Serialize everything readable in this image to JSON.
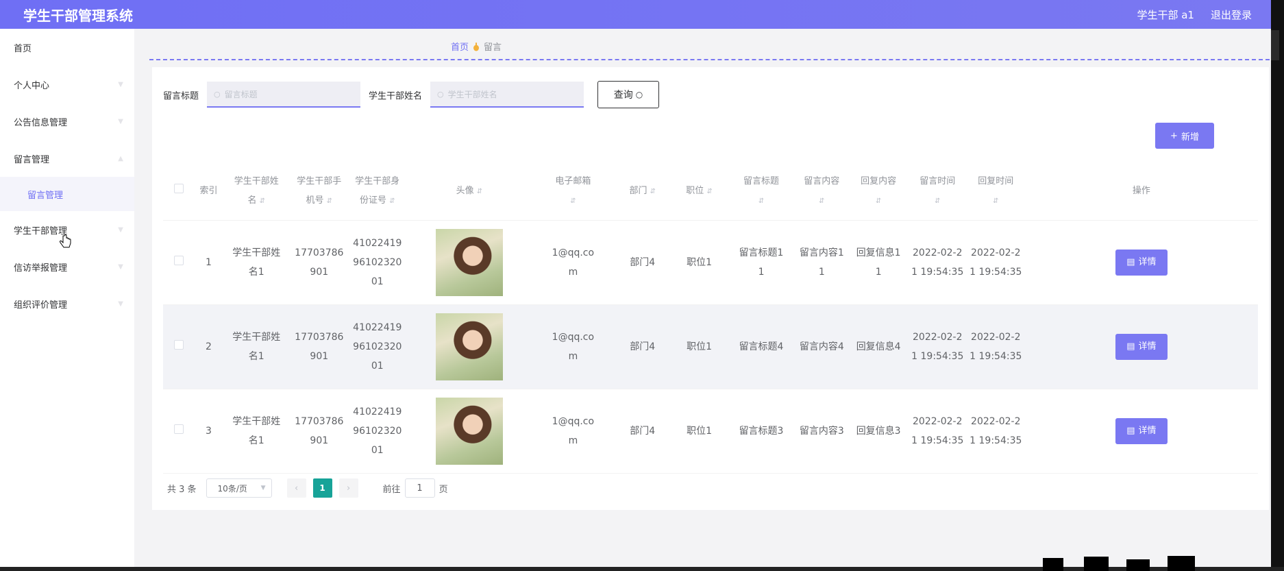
{
  "header": {
    "title": "学生干部管理系统",
    "user": "学生干部 a1",
    "logout": "退出登录"
  },
  "sidebar": {
    "items": [
      {
        "label": "首页"
      },
      {
        "label": "个人中心"
      },
      {
        "label": "公告信息管理"
      },
      {
        "label": "留言管理"
      },
      {
        "label": "学生干部管理"
      },
      {
        "label": "信访举报管理"
      },
      {
        "label": "组织评价管理"
      }
    ],
    "sub_item": "留言管理"
  },
  "breadcrumb": {
    "home": "首页",
    "current": "留言"
  },
  "search": {
    "label1": "留言标题",
    "placeholder1": "留言标题",
    "label2": "学生干部姓名",
    "placeholder2": "学生干部姓名",
    "query_label": "查询"
  },
  "add_label": "新增",
  "table": {
    "headers": {
      "index": "索引",
      "name_a": "学生干部姓",
      "name_b": "名",
      "phone_a": "学生干部手",
      "phone_b": "机号",
      "id_a": "学生干部身",
      "id_b": "份证号",
      "avatar": "头像",
      "email": "电子邮箱",
      "dept": "部门",
      "position": "职位",
      "title": "留言标题",
      "content": "留言内容",
      "reply": "回复内容",
      "time": "留言时间",
      "reply_time": "回复时间",
      "action": "操作"
    },
    "rows": [
      {
        "index": "1",
        "name_a": "学生干部姓",
        "name_b": "名1",
        "phone_a": "17703786",
        "phone_b": "901",
        "id_a": "41022419",
        "id_b": "96102320",
        "id_c": "01",
        "email_a": "1@qq.co",
        "email_b": "m",
        "dept": "部门4",
        "position": "职位1",
        "title_a": "留言标题1",
        "title_b": "1",
        "content_a": "留言内容1",
        "content_b": "1",
        "reply_a": "回复信息1",
        "reply_b": "1",
        "time_a": "2022-02-2",
        "time_b": "1 19:54:35",
        "rtime_a": "2022-02-2",
        "rtime_b": "1 19:54:35",
        "detail": "详情"
      },
      {
        "index": "2",
        "name_a": "学生干部姓",
        "name_b": "名1",
        "phone_a": "17703786",
        "phone_b": "901",
        "id_a": "41022419",
        "id_b": "96102320",
        "id_c": "01",
        "email_a": "1@qq.co",
        "email_b": "m",
        "dept": "部门4",
        "position": "职位1",
        "title_a": "留言标题4",
        "title_b": "",
        "content_a": "留言内容4",
        "content_b": "",
        "reply_a": "回复信息4",
        "reply_b": "",
        "time_a": "2022-02-2",
        "time_b": "1 19:54:35",
        "rtime_a": "2022-02-2",
        "rtime_b": "1 19:54:35",
        "detail": "详情"
      },
      {
        "index": "3",
        "name_a": "学生干部姓",
        "name_b": "名1",
        "phone_a": "17703786",
        "phone_b": "901",
        "id_a": "41022419",
        "id_b": "96102320",
        "id_c": "01",
        "email_a": "1@qq.co",
        "email_b": "m",
        "dept": "部门4",
        "position": "职位1",
        "title_a": "留言标题3",
        "title_b": "",
        "content_a": "留言内容3",
        "content_b": "",
        "reply_a": "回复信息3",
        "reply_b": "",
        "time_a": "2022-02-2",
        "time_b": "1 19:54:35",
        "rtime_a": "2022-02-2",
        "rtime_b": "1 19:54:35",
        "detail": "详情"
      }
    ]
  },
  "pager": {
    "total": "共 3 条",
    "size": "10条/页",
    "current": "1",
    "goto": "前往",
    "goto_value": "1",
    "page_unit": "页"
  },
  "colors": {
    "accent": "#7a78f2",
    "pager_active": "#17a398"
  },
  "icons": {
    "search": "search-icon",
    "add": "plus-icon",
    "detail": "document-icon"
  }
}
